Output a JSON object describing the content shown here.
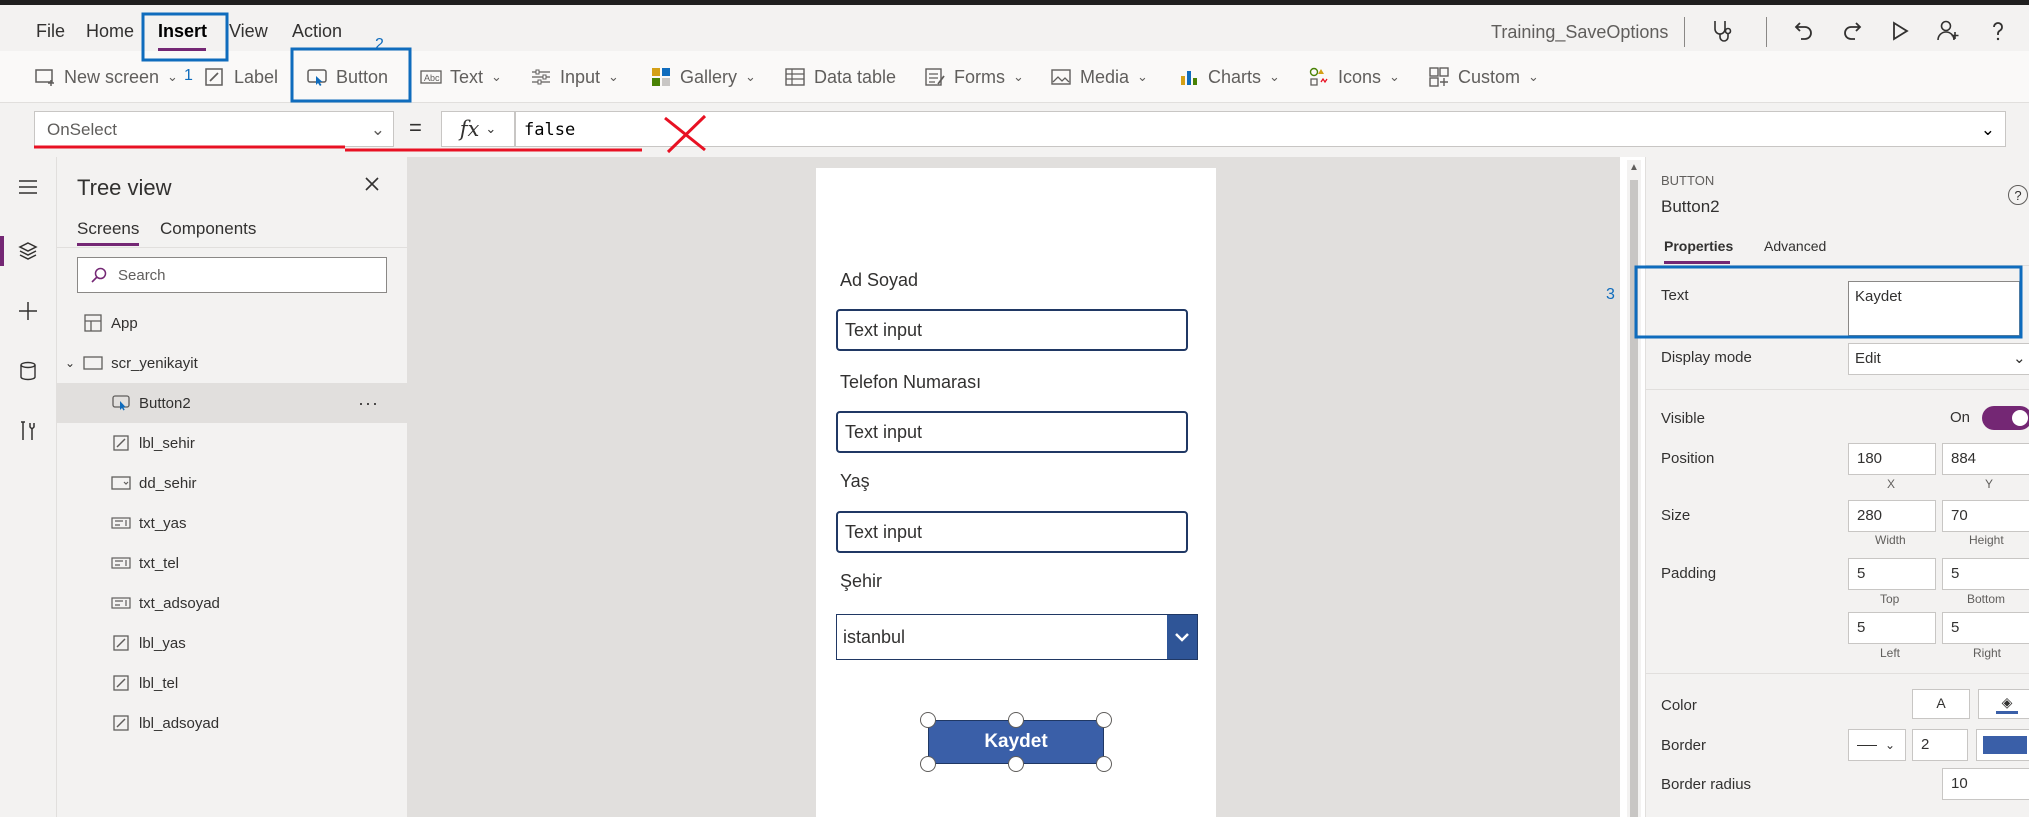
{
  "menubar": {
    "items": [
      "File",
      "Home",
      "Insert",
      "View",
      "Action"
    ],
    "app_title": "Training_SaveOptions",
    "icons": [
      "stethoscope-icon",
      "undo-icon",
      "redo-icon",
      "play-icon",
      "share-user-icon",
      "help-icon"
    ]
  },
  "ribbon": {
    "items": [
      {
        "label": "New screen",
        "icon": "new-screen-icon",
        "dropdown": true
      },
      {
        "label": "Label",
        "icon": "label-icon",
        "dropdown": false
      },
      {
        "label": "Button",
        "icon": "button-icon",
        "dropdown": false
      },
      {
        "label": "Text",
        "icon": "text-icon",
        "dropdown": true
      },
      {
        "label": "Input",
        "icon": "input-icon",
        "dropdown": true
      },
      {
        "label": "Gallery",
        "icon": "gallery-icon",
        "dropdown": true
      },
      {
        "label": "Data table",
        "icon": "data-table-icon",
        "dropdown": false
      },
      {
        "label": "Forms",
        "icon": "forms-icon",
        "dropdown": true
      },
      {
        "label": "Media",
        "icon": "media-icon",
        "dropdown": true
      },
      {
        "label": "Charts",
        "icon": "charts-icon",
        "dropdown": true
      },
      {
        "label": "Icons",
        "icon": "icons-icon",
        "dropdown": true
      },
      {
        "label": "Custom",
        "icon": "custom-icon",
        "dropdown": true
      }
    ]
  },
  "annotations": {
    "n1": "1",
    "n2": "2",
    "n3": "3"
  },
  "formula_bar": {
    "property": "OnSelect",
    "equals": "=",
    "fx": "fx",
    "formula": "false"
  },
  "tree": {
    "title": "Tree view",
    "tabs": [
      "Screens",
      "Components"
    ],
    "search_placeholder": "Search",
    "app_label": "App",
    "screen_label": "scr_yenikayit",
    "items": [
      "Button2",
      "lbl_sehir",
      "dd_sehir",
      "txt_yas",
      "txt_tel",
      "txt_adsoyad",
      "lbl_yas",
      "lbl_tel",
      "lbl_adsoyad"
    ],
    "more": "···"
  },
  "screen": {
    "label_name": "Ad Soyad",
    "input_name": "Text input",
    "label_phone": "Telefon Numarası",
    "input_phone": "Text input",
    "label_age": "Yaş",
    "input_age": "Text input",
    "label_city": "Şehir",
    "city_value": "istanbul",
    "button_label": "Kaydet"
  },
  "panel": {
    "caps": "BUTTON",
    "name": "Button2",
    "help": "?",
    "tabs": [
      "Properties",
      "Advanced"
    ],
    "text_label": "Text",
    "text_value": "Kaydet",
    "display_mode_label": "Display mode",
    "display_mode_value": "Edit",
    "visible_label": "Visible",
    "visible_value": "On",
    "position_label": "Position",
    "position_x": "180",
    "position_y": "884",
    "x_caption": "X",
    "y_caption": "Y",
    "size_label": "Size",
    "size_w": "280",
    "size_h": "70",
    "w_caption": "Width",
    "h_caption": "Height",
    "padding_label": "Padding",
    "pad_top": "5",
    "pad_bottom": "5",
    "pad_left": "5",
    "pad_right": "5",
    "top_caption": "Top",
    "bottom_caption": "Bottom",
    "left_caption": "Left",
    "right_caption": "Right",
    "color_label": "Color",
    "color_a": "A",
    "border_label": "Border",
    "border_width": "2",
    "border_color": "#3a5fa8",
    "radius_label": "Border radius",
    "radius_value": "10"
  },
  "colors": {
    "accent": "#742774",
    "annotation_blue": "#0f6cbd",
    "annotation_red": "#e81123",
    "button_fill": "#3a5fa8"
  }
}
